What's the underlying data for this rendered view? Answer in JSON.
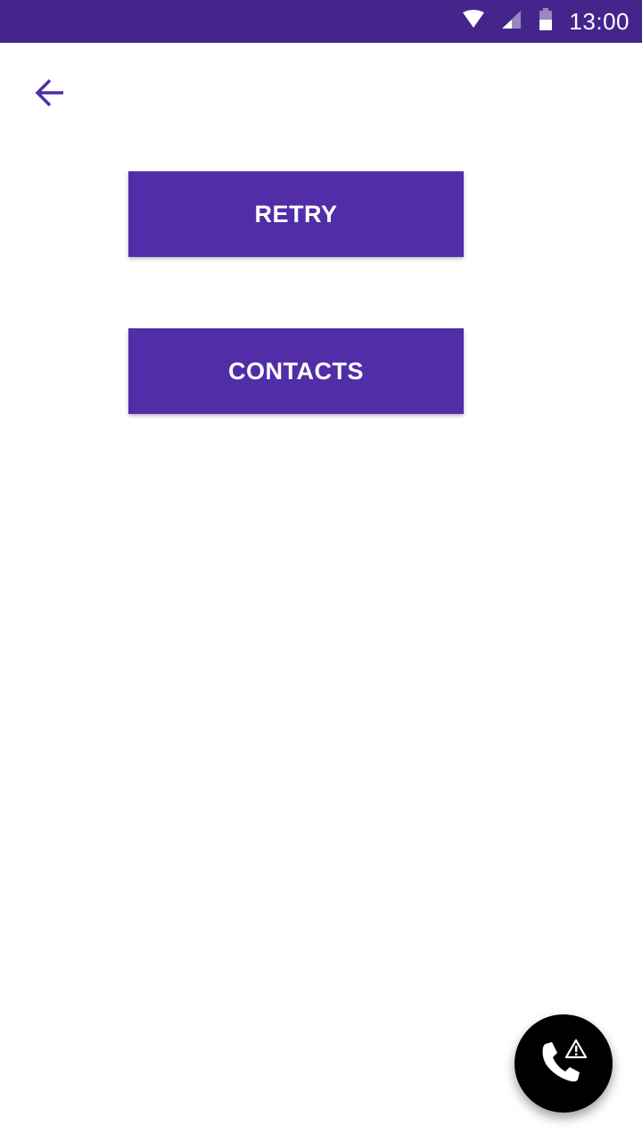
{
  "status_bar": {
    "time": "13:00",
    "icons": [
      "wifi-icon",
      "cellular-signal-icon",
      "battery-icon"
    ],
    "background_color": "#45258c"
  },
  "toolbar": {
    "back_icon": "arrow-back-icon",
    "icon_color": "#512da8"
  },
  "buttons": {
    "retry_label": "RETRY",
    "contacts_label": "CONTACTS",
    "background_color": "#512da8",
    "text_color": "#ffffff"
  },
  "fab": {
    "icon": "phone-warning-icon",
    "background_color": "#000000"
  }
}
